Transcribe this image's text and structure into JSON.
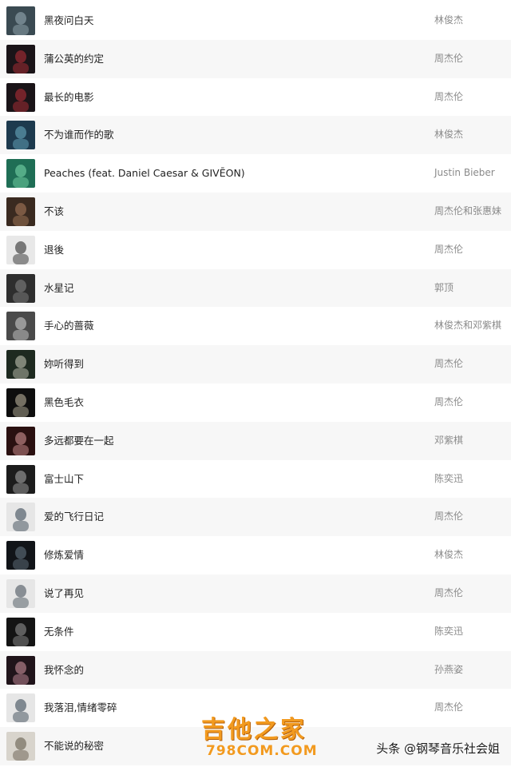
{
  "songs": [
    {
      "title": "黑夜问白天",
      "artist": "林俊杰",
      "cover": {
        "bg": "#3a4a52",
        "fg": "#9fb3bb"
      }
    },
    {
      "title": "蒲公英的约定",
      "artist": "周杰伦",
      "cover": {
        "bg": "#1a1418",
        "fg": "#c0303a"
      }
    },
    {
      "title": "最长的电影",
      "artist": "周杰伦",
      "cover": {
        "bg": "#1a1418",
        "fg": "#c0303a"
      }
    },
    {
      "title": "不为谁而作的歌",
      "artist": "林俊杰",
      "cover": {
        "bg": "#1d3a4e",
        "fg": "#6fb3c9"
      }
    },
    {
      "title": "Peaches (feat. Daniel Caesar & GIVĒON)",
      "artist": "Justin Bieber",
      "cover": {
        "bg": "#1f6e55",
        "fg": "#7fe0b0"
      }
    },
    {
      "title": "不该",
      "artist": "周杰伦和张惠妹",
      "cover": {
        "bg": "#3a2a20",
        "fg": "#b08060"
      }
    },
    {
      "title": "退後",
      "artist": "周杰伦",
      "cover": {
        "bg": "#e8e8e8",
        "fg": "#1a1a1a"
      }
    },
    {
      "title": "水星记",
      "artist": "郭顶",
      "cover": {
        "bg": "#2e2e2e",
        "fg": "#8a8a8a"
      }
    },
    {
      "title": "手心的蔷薇",
      "artist": "林俊杰和邓紫棋",
      "cover": {
        "bg": "#4a4a4a",
        "fg": "#d8d8d8"
      }
    },
    {
      "title": "妳听得到",
      "artist": "周杰伦",
      "cover": {
        "bg": "#1e2a20",
        "fg": "#d0d0c0"
      }
    },
    {
      "title": "黑色毛衣",
      "artist": "周杰伦",
      "cover": {
        "bg": "#0e0e0e",
        "fg": "#c8c0a8"
      }
    },
    {
      "title": "多远都要在一起",
      "artist": "邓紫棋",
      "cover": {
        "bg": "#2a1010",
        "fg": "#e0a0a0"
      }
    },
    {
      "title": "富士山下",
      "artist": "陈奕迅",
      "cover": {
        "bg": "#1c1c1c",
        "fg": "#b0b0b0"
      }
    },
    {
      "title": "爱的飞行日记",
      "artist": "周杰伦",
      "cover": {
        "bg": "#e6e6e6",
        "fg": "#2a3a48"
      }
    },
    {
      "title": "修炼爱情",
      "artist": "林俊杰",
      "cover": {
        "bg": "#111418",
        "fg": "#6a7a88"
      }
    },
    {
      "title": "说了再见",
      "artist": "周杰伦",
      "cover": {
        "bg": "#e6e6e6",
        "fg": "#3a4650"
      }
    },
    {
      "title": "无条件",
      "artist": "陈奕迅",
      "cover": {
        "bg": "#141414",
        "fg": "#9a9a9a"
      }
    },
    {
      "title": "我怀念的",
      "artist": "孙燕姿",
      "cover": {
        "bg": "#20141a",
        "fg": "#d89aa8"
      }
    },
    {
      "title": "我落泪,情绪零碎",
      "artist": "周杰伦",
      "cover": {
        "bg": "#e6e6e6",
        "fg": "#2a3a48"
      }
    },
    {
      "title": "不能说的秘密",
      "artist": "",
      "cover": {
        "bg": "#d8d4cc",
        "fg": "#5a5040"
      }
    }
  ],
  "watermark": {
    "main": "吉他之家",
    "sub": "798COM.COM"
  },
  "source": "头条 @钢琴音乐社会姐"
}
